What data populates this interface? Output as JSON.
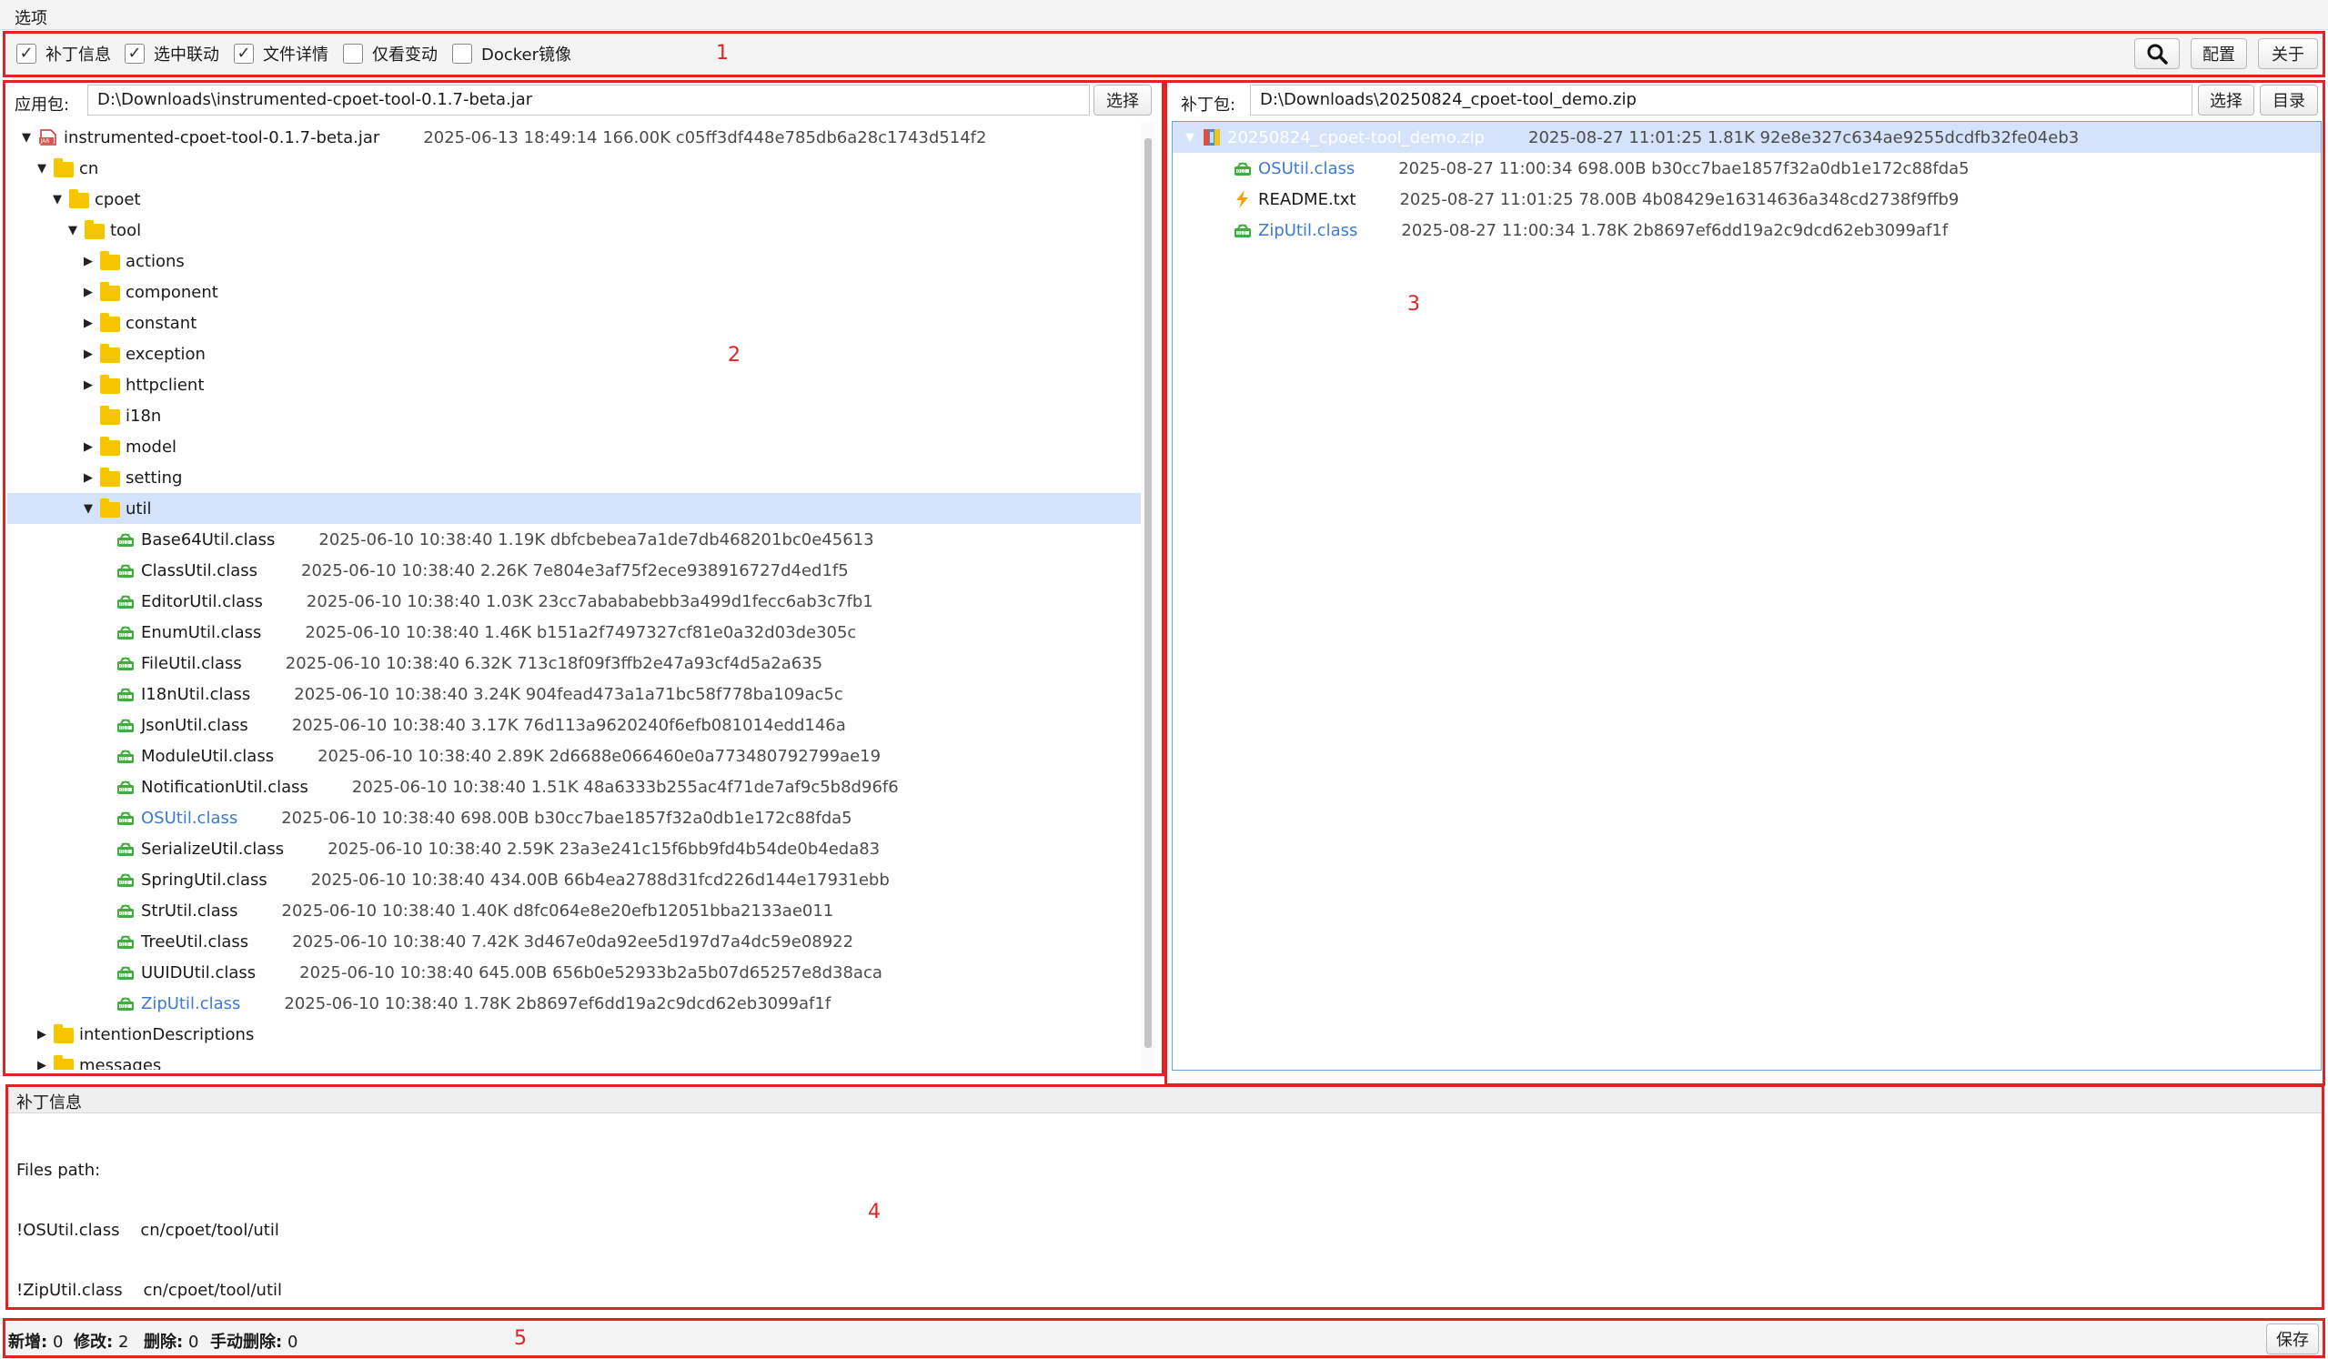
{
  "menubar": {
    "options": "选项"
  },
  "toolbar": {
    "checkboxes": [
      {
        "label": "补丁信息",
        "checked": true
      },
      {
        "label": "选中联动",
        "checked": true
      },
      {
        "label": "文件详情",
        "checked": true
      },
      {
        "label": "仅看变动",
        "checked": false
      },
      {
        "label": "Docker镜像",
        "checked": false
      }
    ],
    "config_label": "配置",
    "about_label": "关于"
  },
  "app_panel": {
    "label": "应用包:",
    "path": "D:\\Downloads\\instrumented-cpoet-tool-0.1.7-beta.jar",
    "select_label": "选择",
    "tree": [
      {
        "name": "instrumented-cpoet-tool-0.1.7-beta.jar",
        "meta": "2025-06-13 18:49:14  166.00K  c05ff3df448e785db6a28c1743d514f2",
        "icon": "jar-icon",
        "level": 0,
        "arrow": "down"
      },
      {
        "name": "cn",
        "meta": "",
        "icon": "folder-icon",
        "level": 1,
        "arrow": "down"
      },
      {
        "name": "cpoet",
        "meta": "",
        "icon": "folder-icon",
        "level": 2,
        "arrow": "down"
      },
      {
        "name": "tool",
        "meta": "",
        "icon": "folder-icon",
        "level": 3,
        "arrow": "down"
      },
      {
        "name": "actions",
        "meta": "",
        "icon": "folder-icon",
        "level": 4,
        "arrow": "right"
      },
      {
        "name": "component",
        "meta": "",
        "icon": "folder-icon",
        "level": 4,
        "arrow": "right"
      },
      {
        "name": "constant",
        "meta": "",
        "icon": "folder-icon",
        "level": 4,
        "arrow": "right"
      },
      {
        "name": "exception",
        "meta": "",
        "icon": "folder-icon",
        "level": 4,
        "arrow": "right"
      },
      {
        "name": "httpclient",
        "meta": "",
        "icon": "folder-icon",
        "level": 4,
        "arrow": "right"
      },
      {
        "name": "i18n",
        "meta": "",
        "icon": "folder-icon",
        "level": 4,
        "arrow": ""
      },
      {
        "name": "model",
        "meta": "",
        "icon": "folder-icon",
        "level": 4,
        "arrow": "right"
      },
      {
        "name": "setting",
        "meta": "",
        "icon": "folder-icon",
        "level": 4,
        "arrow": "right"
      },
      {
        "name": "util",
        "meta": "",
        "icon": "folder-icon",
        "level": 4,
        "arrow": "down",
        "selected": true
      },
      {
        "name": "Base64Util.class",
        "meta": "2025-06-10 10:38:40  1.19K  dbfcbebea7a1de7db468201bc0e45613",
        "icon": "class-file-icon",
        "level": 5,
        "arrow": ""
      },
      {
        "name": "ClassUtil.class",
        "meta": "2025-06-10 10:38:40  2.26K  7e804e3af75f2ece938916727d4ed1f5",
        "icon": "class-file-icon",
        "level": 5,
        "arrow": ""
      },
      {
        "name": "EditorUtil.class",
        "meta": "2025-06-10 10:38:40  1.03K  23cc7abababebb3a499d1fecc6ab3c7fb1",
        "icon": "class-file-icon",
        "level": 5,
        "arrow": ""
      },
      {
        "name": "EnumUtil.class",
        "meta": "2025-06-10 10:38:40  1.46K  b151a2f7497327cf81e0a32d03de305c",
        "icon": "class-file-icon",
        "level": 5,
        "arrow": ""
      },
      {
        "name": "FileUtil.class",
        "meta": "2025-06-10 10:38:40  6.32K  713c18f09f3ffb2e47a93cf4d5a2a635",
        "icon": "class-file-icon",
        "level": 5,
        "arrow": ""
      },
      {
        "name": "I18nUtil.class",
        "meta": "2025-06-10 10:38:40  3.24K  904fead473a1a71bc58f778ba109ac5c",
        "icon": "class-file-icon",
        "level": 5,
        "arrow": ""
      },
      {
        "name": "JsonUtil.class",
        "meta": "2025-06-10 10:38:40  3.17K  76d113a9620240f6efb081014edd146a",
        "icon": "class-file-icon",
        "level": 5,
        "arrow": ""
      },
      {
        "name": "ModuleUtil.class",
        "meta": "2025-06-10 10:38:40  2.89K  2d6688e066460e0a773480792799ae19",
        "icon": "class-file-icon",
        "level": 5,
        "arrow": ""
      },
      {
        "name": "NotificationUtil.class",
        "meta": "2025-06-10 10:38:40  1.51K  48a6333b255ac4f71de7af9c5b8d96f6",
        "icon": "class-file-icon",
        "level": 5,
        "arrow": ""
      },
      {
        "name": "OSUtil.class",
        "meta": "2025-06-10 10:38:40  698.00B  b30cc7bae1857f32a0db1e172c88fda5",
        "icon": "class-file-icon",
        "level": 5,
        "arrow": "",
        "changed": true
      },
      {
        "name": "SerializeUtil.class",
        "meta": "2025-06-10 10:38:40  2.59K  23a3e241c15f6bb9fd4b54de0b4eda83",
        "icon": "class-file-icon",
        "level": 5,
        "arrow": ""
      },
      {
        "name": "SpringUtil.class",
        "meta": "2025-06-10 10:38:40  434.00B  66b4ea2788d31fcd226d144e17931ebb",
        "icon": "class-file-icon",
        "level": 5,
        "arrow": ""
      },
      {
        "name": "StrUtil.class",
        "meta": "2025-06-10 10:38:40  1.40K  d8fc064e8e20efb12051bba2133ae011",
        "icon": "class-file-icon",
        "level": 5,
        "arrow": ""
      },
      {
        "name": "TreeUtil.class",
        "meta": "2025-06-10 10:38:40  7.42K  3d467e0da92ee5d197d7a4dc59e08922",
        "icon": "class-file-icon",
        "level": 5,
        "arrow": ""
      },
      {
        "name": "UUIDUtil.class",
        "meta": "2025-06-10 10:38:40  645.00B  656b0e52933b2a5b07d65257e8d38aca",
        "icon": "class-file-icon",
        "level": 5,
        "arrow": ""
      },
      {
        "name": "ZipUtil.class",
        "meta": "2025-06-10 10:38:40  1.78K  2b8697ef6dd19a2c9dcd62eb3099af1f",
        "icon": "class-file-icon",
        "level": 5,
        "arrow": "",
        "changed": true
      },
      {
        "name": "intentionDescriptions",
        "meta": "",
        "icon": "folder-icon",
        "level": 1,
        "arrow": "right"
      },
      {
        "name": "messages",
        "meta": "",
        "icon": "folder-icon",
        "level": 1,
        "arrow": "right"
      }
    ]
  },
  "patch_panel": {
    "label": "补丁包:",
    "path": "D:\\Downloads\\20250824_cpoet-tool_demo.zip",
    "select_label": "选择",
    "dir_label": "目录",
    "tree": [
      {
        "name": "20250824_cpoet-tool_demo.zip",
        "meta": "2025-08-27 11:01:25  1.81K  92e8e327c634ae9255dcdfb32fe04eb3",
        "icon": "zip-icon",
        "level": 0,
        "arrow": "down",
        "selected": true
      },
      {
        "name": "OSUtil.class",
        "meta": "2025-08-27 11:00:34  698.00B  b30cc7bae1857f32a0db1e172c88fda5",
        "icon": "class-file-icon",
        "level": 1,
        "arrow": "",
        "changed": true
      },
      {
        "name": "README.txt",
        "meta": "2025-08-27 11:01:25  78.00B  4b08429e16314636a348cd2738f9ffb9",
        "icon": "lightning-icon",
        "level": 1,
        "arrow": ""
      },
      {
        "name": "ZipUtil.class",
        "meta": "2025-08-27 11:00:34  1.78K  2b8697ef6dd19a2c9dcd62eb3099af1f",
        "icon": "class-file-icon",
        "level": 1,
        "arrow": "",
        "changed": true
      }
    ]
  },
  "patch_info": {
    "title": "补丁信息",
    "lines": [
      "Files path:",
      "!OSUtil.class    cn/cpoet/tool/util",
      "!ZipUtil.class    cn/cpoet/tool/util"
    ]
  },
  "status": {
    "added_label": "新增:",
    "added": "0",
    "modified_label": "修改:",
    "modified": "2",
    "deleted_label": "删除:",
    "deleted": "0",
    "manual_label": "手动删除:",
    "manual": "0",
    "save_label": "保存"
  },
  "regions": [
    "1",
    "2",
    "3",
    "4",
    "5"
  ],
  "colors": {
    "annotation": "#e02424",
    "selection": "#d4e2fb",
    "changed_text": "#3d7ad6",
    "folder": "#f7c500"
  }
}
